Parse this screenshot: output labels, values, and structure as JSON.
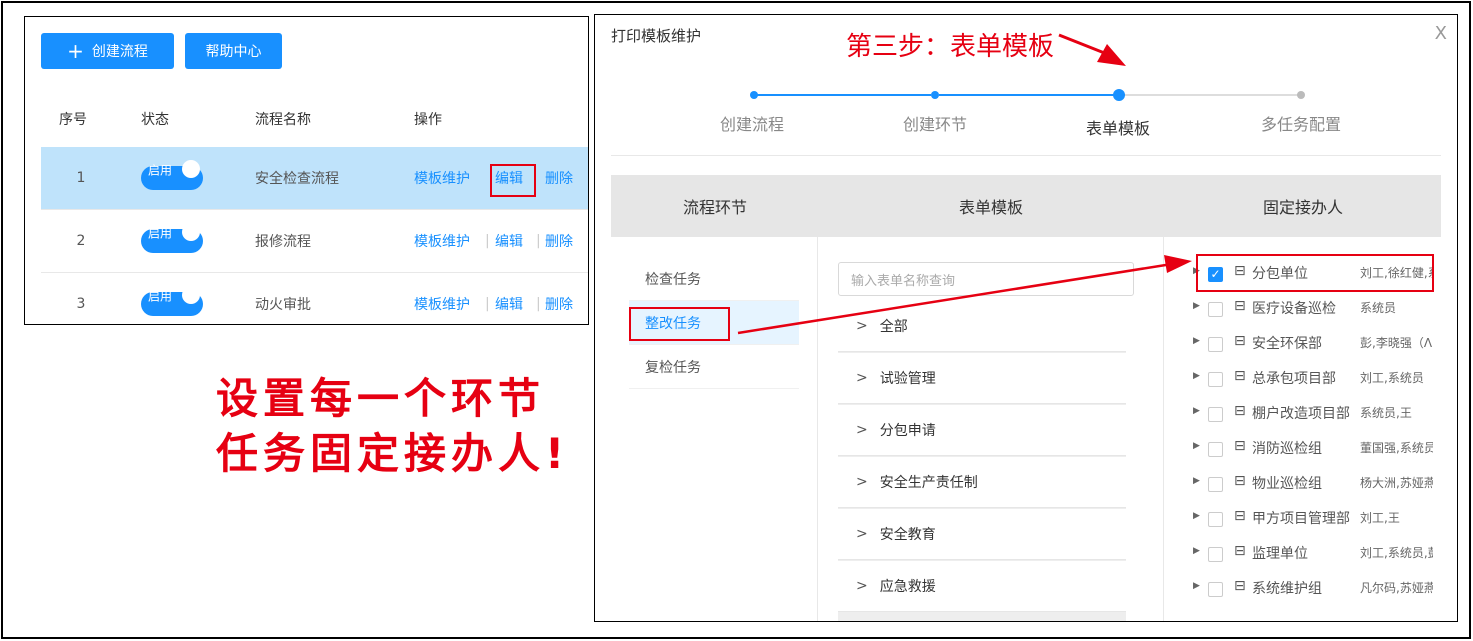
{
  "left": {
    "create_button": "创建流程",
    "help_button": "帮助中心",
    "columns": [
      "序号",
      "状态",
      "流程名称",
      "操作"
    ],
    "rows": [
      {
        "no": "1",
        "status": "启用",
        "name": "安全检查流程"
      },
      {
        "no": "2",
        "status": "启用",
        "name": "报修流程"
      },
      {
        "no": "3",
        "status": "启用",
        "name": "动火审批"
      }
    ],
    "ops": {
      "template": "模板维护",
      "edit": "编辑",
      "delete": "删除",
      "sep": "|"
    }
  },
  "annotation": {
    "line1": "设置每一个环节",
    "line2": "任务固定接办人!",
    "step_callout": "第三步：表单模板"
  },
  "dialog": {
    "title": "打印模板维护",
    "close": "X",
    "steps": [
      "创建流程",
      "创建环节",
      "表单模板",
      "多任务配置"
    ],
    "active_step": 3,
    "headers": [
      "流程环节",
      "表单模板",
      "固定接办人"
    ],
    "tasks": [
      "检查任务",
      "整改任务",
      "复检任务"
    ],
    "search_placeholder": "输入表单名称查询",
    "forms": [
      "全部",
      "试验管理",
      "分包申请",
      "安全生产责任制",
      "安全教育",
      "应急救援"
    ],
    "departments": [
      {
        "name": "分包单位",
        "members": "刘工,徐红健,系统",
        "checked": true
      },
      {
        "name": "医疗设备巡检",
        "members": "系统员",
        "checked": false
      },
      {
        "name": "安全环保部",
        "members": "彭,李晓强（ᐱ",
        "checked": false
      },
      {
        "name": "总承包项目部",
        "members": "刘工,系统员",
        "checked": false
      },
      {
        "name": "棚户改造项目部",
        "members": "系统员,王",
        "checked": false
      },
      {
        "name": "消防巡检组",
        "members": "董国强,系统员",
        "checked": false
      },
      {
        "name": "物业巡检组",
        "members": "杨大洲,苏娅燕",
        "checked": false
      },
      {
        "name": "甲方项目管理部",
        "members": "刘工,王",
        "checked": false
      },
      {
        "name": "监理单位",
        "members": "刘工,系统员,彭",
        "checked": false
      },
      {
        "name": "系统维护组",
        "members": "凡尔码,苏娅燕",
        "checked": false
      }
    ],
    "check_mark": "✓",
    "dept_icon": "⊟"
  },
  "colors": {
    "primary": "#1890ff",
    "highlight": "#e60012",
    "selected_row": "#bfe3fb"
  }
}
